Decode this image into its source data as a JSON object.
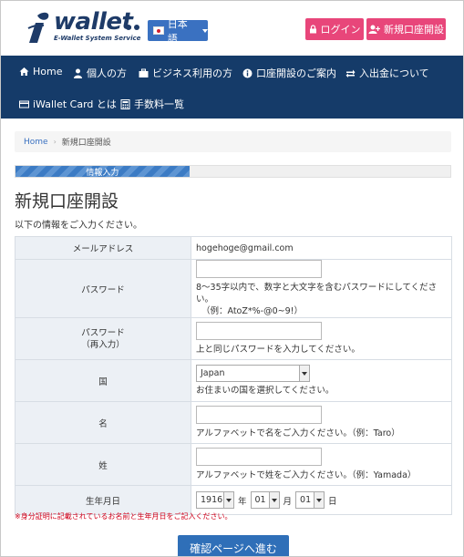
{
  "header": {
    "logo_word": "wallet",
    "logo_tagline": "E-Wallet System Service",
    "language_label": "日本語",
    "login_label": "ログイン",
    "signup_label": "新規口座開設"
  },
  "nav": {
    "items": [
      {
        "label": "Home",
        "icon": "home-icon"
      },
      {
        "label": "個人の方",
        "icon": "user-icon"
      },
      {
        "label": "ビジネス利用の方",
        "icon": "briefcase-icon"
      },
      {
        "label": "口座開設のご案内",
        "icon": "info-icon"
      },
      {
        "label": "入出金について",
        "icon": "exchange-icon"
      },
      {
        "label": "iWallet Card とは",
        "icon": "credit-card-icon"
      },
      {
        "label": "手数料一覧",
        "icon": "calculator-icon"
      }
    ]
  },
  "breadcrumb": {
    "home": "Home",
    "current": "新規口座開設"
  },
  "progress": {
    "label": "情報入力",
    "fraction": 0.4
  },
  "page": {
    "title": "新規口座開設",
    "subtitle": "以下の情報をご入力ください。"
  },
  "form": {
    "email": {
      "label": "メールアドレス",
      "value": "hogehoge@gmail.com"
    },
    "password": {
      "label": "パスワード",
      "hint_line1": "8～35字以内で、数字と大文字を含むパスワードにしてください。",
      "hint_line2": "（例：AtoZ*%-@0~9!）"
    },
    "password_confirm": {
      "label_line1": "パスワード",
      "label_line2": "（再入力）",
      "hint": "上と同じパスワードを入力してください。"
    },
    "country": {
      "label": "国",
      "value": "Japan",
      "hint": "お住まいの国を選択してください。"
    },
    "first_name": {
      "label": "名",
      "hint": "アルファベットで名をご入力ください。（例：Taro）"
    },
    "last_name": {
      "label": "姓",
      "hint": "アルファベットで姓をご入力ください。（例：Yamada）"
    },
    "birthdate": {
      "label": "生年月日",
      "year": "1916",
      "year_unit": "年",
      "month": "01",
      "month_unit": "月",
      "day": "01",
      "day_unit": "日"
    }
  },
  "note": "※身分証明に記載されているお名前と生年月日をご記入ください。",
  "submit_label": "確認ページへ進む",
  "colors": {
    "nav_bg": "#153b69",
    "accent_pink": "#e8467a",
    "accent_blue": "#3a71c1"
  }
}
